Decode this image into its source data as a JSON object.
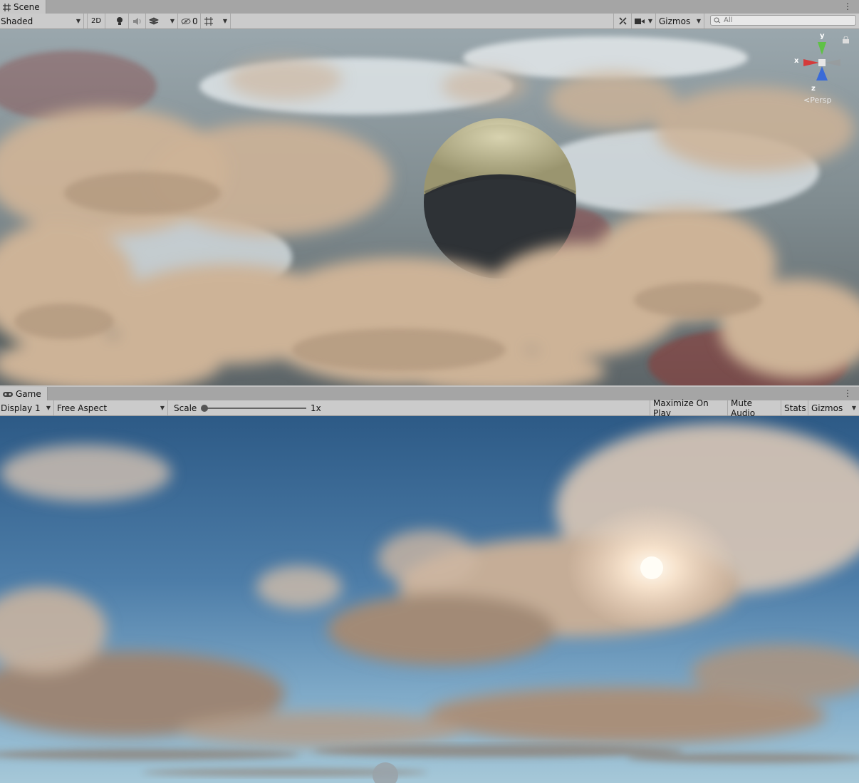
{
  "scene_panel": {
    "tab_label": "Scene",
    "toolbar": {
      "draw_mode": "Shaded",
      "mode_2d": "2D",
      "hidden_count": "0",
      "gizmos": "Gizmos",
      "search_placeholder": "All"
    },
    "orientation_gizmo": {
      "x": "x",
      "y": "y",
      "z": "z",
      "projection": "Persp"
    }
  },
  "game_panel": {
    "tab_label": "Game",
    "toolbar": {
      "display": "Display 1",
      "aspect": "Free Aspect",
      "scale_label": "Scale",
      "scale_value": "1x",
      "scale_level": 0,
      "maximize_on_play": "Maximize On Play",
      "mute_audio": "Mute Audio",
      "stats": "Stats",
      "gizmos": "Gizmos"
    }
  },
  "icons": [
    "scene-grid-icon",
    "lightbulb-icon",
    "audio-icon",
    "effects-icon",
    "hidden-eye-icon",
    "grid-icon",
    "tools-icon",
    "camera-icon",
    "search-icon",
    "lock-icon",
    "gamepad-icon",
    "kebab-menu-icon"
  ]
}
